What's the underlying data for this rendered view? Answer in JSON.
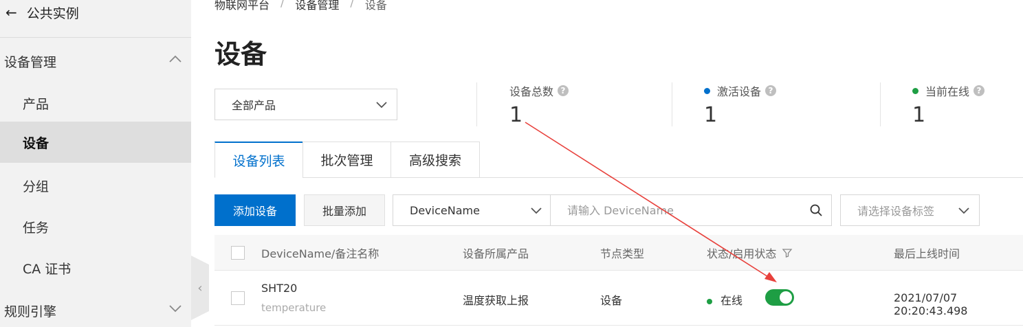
{
  "sidebar": {
    "back_label": "公共实例",
    "sections": [
      {
        "label": "设备管理",
        "expanded": true
      },
      {
        "label": "规则引擎",
        "expanded": false
      }
    ],
    "items": [
      {
        "label": "产品",
        "active": false
      },
      {
        "label": "设备",
        "active": true
      },
      {
        "label": "分组",
        "active": false
      },
      {
        "label": "任务",
        "active": false
      },
      {
        "label": "CA 证书",
        "active": false
      }
    ]
  },
  "breadcrumb": [
    "物联网平台",
    "设备管理",
    "设备"
  ],
  "page_title": "设备",
  "product_filter": {
    "value": "全部产品"
  },
  "stats": [
    {
      "label": "设备总数",
      "value": "1",
      "dot_color": null
    },
    {
      "label": "激活设备",
      "value": "1",
      "dot_color": "#0070cc"
    },
    {
      "label": "当前在线",
      "value": "1",
      "dot_color": "#1e9e44"
    }
  ],
  "tabs": [
    {
      "label": "设备列表",
      "active": true
    },
    {
      "label": "批次管理",
      "active": false
    },
    {
      "label": "高级搜索",
      "active": false
    }
  ],
  "toolbar": {
    "add_device": "添加设备",
    "batch_add": "批量添加",
    "field_select": "DeviceName",
    "search_placeholder": "请输入 DeviceName",
    "tag_placeholder": "请选择设备标签"
  },
  "table": {
    "columns": [
      "DeviceName/备注名称",
      "设备所属产品",
      "节点类型",
      "状态/启用状态",
      "最后上线时间"
    ],
    "rows": [
      {
        "device_name": "SHT20",
        "remark": "temperature",
        "product": "温度获取上报",
        "node_type": "设备",
        "status": "在线",
        "enabled": true,
        "last_online": "2021/07/07 20:20:43.498"
      }
    ]
  },
  "colors": {
    "primary": "#0070cc",
    "online": "#1e9e44",
    "annotation_arrow": "#e8413c"
  }
}
